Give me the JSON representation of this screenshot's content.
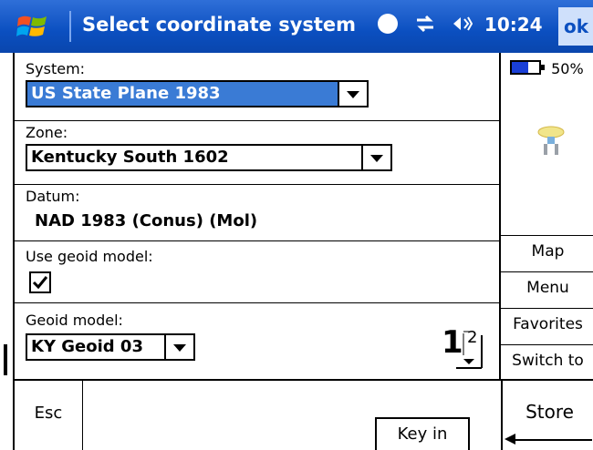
{
  "titlebar": {
    "title": "Select coordinate system",
    "time": "10:24",
    "ok_label": "ok",
    "start_icon": "windows-flag-icon",
    "status_icons": [
      "sync-icon",
      "connectivity-icon",
      "volume-icon"
    ]
  },
  "form": {
    "system_label": "System:",
    "system_value": "US State Plane 1983",
    "zone_label": "Zone:",
    "zone_value": "Kentucky South 1602",
    "datum_label": "Datum:",
    "datum_value": "NAD 1983 (Conus) (Mol)",
    "geoid_use_label": "Use geoid model:",
    "geoid_use_checked": true,
    "geoid_model_label": "Geoid model:",
    "geoid_model_value": "KY Geoid 03"
  },
  "pager": {
    "current": "1",
    "total": "2"
  },
  "side_panel": {
    "battery_percent": "50%",
    "antenna_icon": "gnss-receiver-icon",
    "buttons": [
      "Map",
      "Menu",
      "Favorites",
      "Switch to"
    ]
  },
  "bottom_bar": {
    "esc_label": "Esc",
    "keyin_label": "Key in",
    "store_label": "Store"
  },
  "colors": {
    "titlebar": "#0b4fc0",
    "selection": "#3a7bd5"
  }
}
